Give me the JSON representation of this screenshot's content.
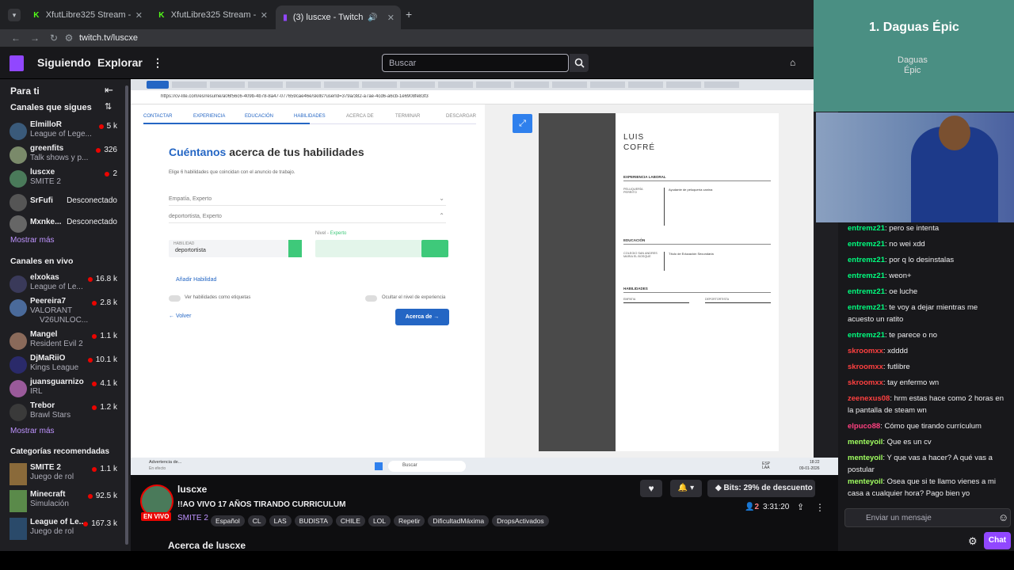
{
  "browser": {
    "tabs": [
      {
        "title": "XfutLibre325 Stream - Watch Li",
        "active": false
      },
      {
        "title": "XfutLibre325 Stream - Kick Das",
        "active": false
      },
      {
        "title": "(3) luscxe - Twitch",
        "active": true
      }
    ],
    "url": "twitch.tv/luscxe"
  },
  "topnav": {
    "following": "Siguiendo",
    "browse": "Explorar",
    "search_placeholder": "Buscar"
  },
  "sidebar": {
    "for_you": "Para ti",
    "followed_heading": "Canales que sigues",
    "followed": [
      {
        "name": "ElmilloR",
        "game": "League of Lege...",
        "viewers": "5 k",
        "live": true,
        "color": "#3a5a7a"
      },
      {
        "name": "greenfits",
        "game": "Talk shows y p...",
        "viewers": "326",
        "live": true,
        "color": "#7a8a6a"
      },
      {
        "name": "luscxe",
        "game": "SMITE 2",
        "viewers": "2",
        "live": true,
        "color": "#4a7a5a"
      },
      {
        "name": "SrFufi",
        "status": "Desconectado",
        "live": false,
        "color": "#555"
      },
      {
        "name": "Mxnke...",
        "status": "Desconectado",
        "live": false,
        "color": "#666"
      }
    ],
    "show_more_1": "Mostrar más",
    "live_heading": "Canales en vivo",
    "live": [
      {
        "name": "elxokas",
        "game": "League of Le...",
        "viewers": "16.8 k",
        "color": "#3a3a5a"
      },
      {
        "name": "Peereira7",
        "game": "VALORANT",
        "extra": "V26UNLOC...",
        "viewers": "2.8 k",
        "color": "#4a6a9a"
      },
      {
        "name": "Mangel",
        "game": "Resident Evil 2",
        "viewers": "1.1 k",
        "color": "#8a6a5a"
      },
      {
        "name": "DjMaRiiO",
        "game": "Kings League",
        "viewers": "10.1 k",
        "color": "#2a2a6a"
      },
      {
        "name": "juansguarnizo",
        "game": "IRL",
        "viewers": "4.1 k",
        "color": "#9a5a9a"
      },
      {
        "name": "Trebor",
        "game": "Brawl Stars",
        "viewers": "1.2 k",
        "color": "#3a3a3a"
      }
    ],
    "show_more_2": "Mostrar más",
    "categories_heading": "Categorías recomendadas",
    "categories": [
      {
        "name": "SMITE 2",
        "sub": "Juego de rol",
        "viewers": "1.1 k",
        "color": "#8a6a3a"
      },
      {
        "name": "Minecraft",
        "sub": "Simulación",
        "viewers": "92.5 k",
        "color": "#5a8a4a"
      },
      {
        "name": "League of Le...",
        "sub": "Juego de rol",
        "viewers": "167.3 k",
        "color": "#2a4a6a"
      }
    ]
  },
  "stream_content": {
    "inner_url": "https://cv-lite.com/es/resume/a06f56c6-409b-4b78-8a47-077659cae46e/skills?userId=379a/382-a7ae-4cd6-a6cb-1e6908fe83f3",
    "cv_nav": [
      "CONTACTAR",
      "EXPERIENCIA",
      "EDUCACIÓN",
      "HABILIDADES",
      "ACERCA DE",
      "TERMINAR",
      "DESCARGAR"
    ],
    "heading_accent": "Cuéntanos",
    "heading_rest": " acerca de tus habilidades",
    "sub": "Elige 6 habilidades que coincidan con el anuncio de trabajo.",
    "skill1": "Empatía, Experto",
    "skill2": "deportortista, Experto",
    "skill_label": "HABILIDAD",
    "skill_value": "deportortista",
    "level_label": "Nivel",
    "level_value": "Experto",
    "add_skill": "Añadir Habilidad",
    "toggle1": "Ver habilidades como etiquetas",
    "toggle2": "Ocultar el nivel de experiencia",
    "back": "Volver",
    "next": "Acerca de",
    "resume_name1": "LUIS",
    "resume_name2": "COFRÉ",
    "res_exp": "EXPERIENCIA LABORAL",
    "res_edu": "EDUCACIÓN",
    "res_skills": "HABILIDADES",
    "res_job": "Ayudante de peluquería canina",
    "res_employer": "PELUQUERÍA PERRITO",
    "res_city": "Santiago",
    "res_school": "COLEGIO SAN ANDRES MARIA EL BOSQUE",
    "res_degree": "Título de Educación Secundaria",
    "res_skill_1": "EMPATIA",
    "res_skill_2": "DEPORTORTISTA",
    "taskbar_search": "Buscar",
    "taskbar_notice": "Advertencia de...",
    "taskbar_notice_sub": "En efecto",
    "taskbar_lang": "ESP LAA",
    "taskbar_time": "18:22",
    "taskbar_date": "09-01-2026"
  },
  "overlay": {
    "rank_title": "1. Daguas Épic",
    "map_label1": "Daguas",
    "map_label2": "Épic"
  },
  "chat": {
    "messages": [
      {
        "user": "entremz21",
        "text": "pero se intenta",
        "color": "#00ff7f"
      },
      {
        "user": "entremz21",
        "text": "no wei xdd",
        "color": "#00ff7f"
      },
      {
        "user": "entremz21",
        "text": "por q lo desinstalas",
        "color": "#00ff7f"
      },
      {
        "user": "entremz21",
        "text": "weon+",
        "color": "#00ff7f"
      },
      {
        "user": "entremz21",
        "text": "oe luche",
        "color": "#00ff7f"
      },
      {
        "user": "entremz21",
        "text": "te voy a dejar mientras me acuesto un ratito",
        "color": "#00ff7f"
      },
      {
        "user": "entremz21",
        "text": "te parece o no",
        "color": "#00ff7f"
      },
      {
        "user": "skroomxx",
        "text": "xdddd",
        "color": "#ff4040"
      },
      {
        "user": "skroomxx",
        "text": "futlibre",
        "color": "#ff4040"
      },
      {
        "user": "skroomxx",
        "text": "tay enfermo wn",
        "color": "#ff4040"
      },
      {
        "user": "zeenexus08",
        "text": "hrm estas hace como 2 horas en la pantalla de steam wn",
        "color": "#ff4040"
      },
      {
        "user": "elpuco88",
        "text": "Cómo que tirando currículum",
        "color": "#ff4080"
      },
      {
        "user": "menteyoil",
        "text": "Que es un cv",
        "color": "#a0ff60"
      },
      {
        "user": "menteyoil",
        "text": "Y que vas a hacer? A qué vas a postular",
        "color": "#a0ff60"
      },
      {
        "user": "menteyoil",
        "text": "Osea que si te llamo vienes a mi casa a cualquier hora? Pago bien yo",
        "color": "#a0ff60"
      }
    ],
    "input_placeholder": "Enviar un mensaje",
    "chat_button": "Chat"
  },
  "stream_info": {
    "channel": "luscxe",
    "title": "!!AO VIVO 17 AÑOS TIRANDO CURRICULUM",
    "live_badge": "EN VIVO",
    "game": "SMITE 2",
    "tags": [
      "Español",
      "CL",
      "LAS",
      "BUDISTA",
      "CHILE",
      "LOL",
      "Repetir",
      "DificultadMáxima",
      "DropsActivados"
    ],
    "viewers": "2",
    "uptime": "3:31:20",
    "bits": "Bits: 29% de descuento",
    "about": "Acerca de luscxe"
  }
}
